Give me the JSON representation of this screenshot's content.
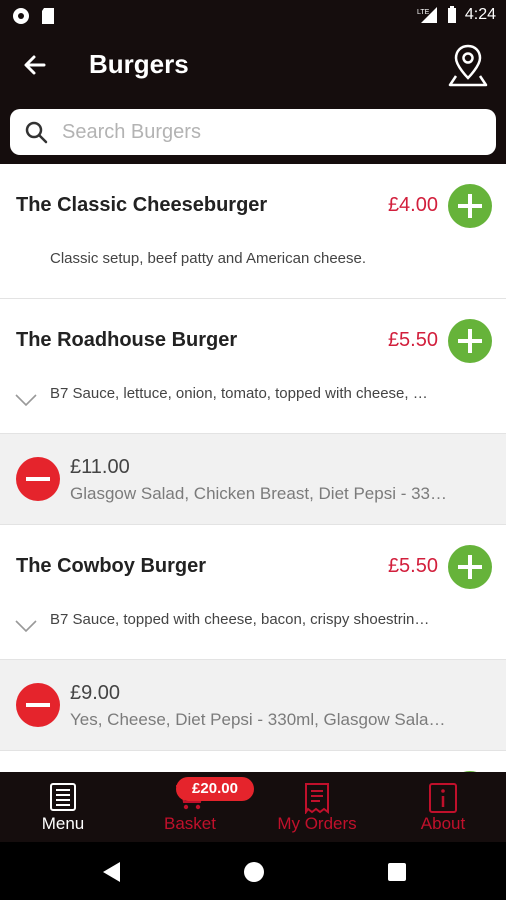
{
  "status_bar": {
    "time": "4:24",
    "network": "LTE"
  },
  "app_bar": {
    "title": "Burgers"
  },
  "search": {
    "placeholder": "Search Burgers",
    "value": ""
  },
  "menu_items": [
    {
      "name": "The Classic Cheeseburger",
      "price": "£4.00",
      "description": "Classic setup, beef patty and American cheese."
    },
    {
      "name": "The Roadhouse Burger",
      "price": "£5.50",
      "description": "B7 Sauce, lettuce, onion, tomato, topped with cheese, …"
    },
    {
      "name": "The Cowboy Burger",
      "price": "£5.50",
      "description": "B7 Sauce, topped with cheese, bacon, crispy shoestrin…"
    }
  ],
  "basket_entries": [
    {
      "price": "£11.00",
      "details": "Glasgow Salad, Chicken Breast, Diet Pepsi - 33…"
    },
    {
      "price": "£9.00",
      "details": "Yes, Cheese, Diet Pepsi - 330ml, Glasgow Sala…"
    }
  ],
  "bottom_nav": {
    "menu_label": "Menu",
    "basket_label": "Basket",
    "basket_total": "£20.00",
    "orders_label": "My Orders",
    "about_label": "About"
  },
  "colors": {
    "dark": "#150d0d",
    "accent_red": "#d21f3c",
    "badge_red": "#e5242c",
    "add_green": "#66b33a",
    "active_nav": "#ffffff"
  },
  "icons": [
    "back-arrow-icon",
    "location-pin-icon",
    "search-icon",
    "add-icon",
    "remove-icon",
    "chevron-down-icon",
    "menu-book-icon",
    "cart-icon",
    "receipt-icon",
    "info-icon"
  ]
}
